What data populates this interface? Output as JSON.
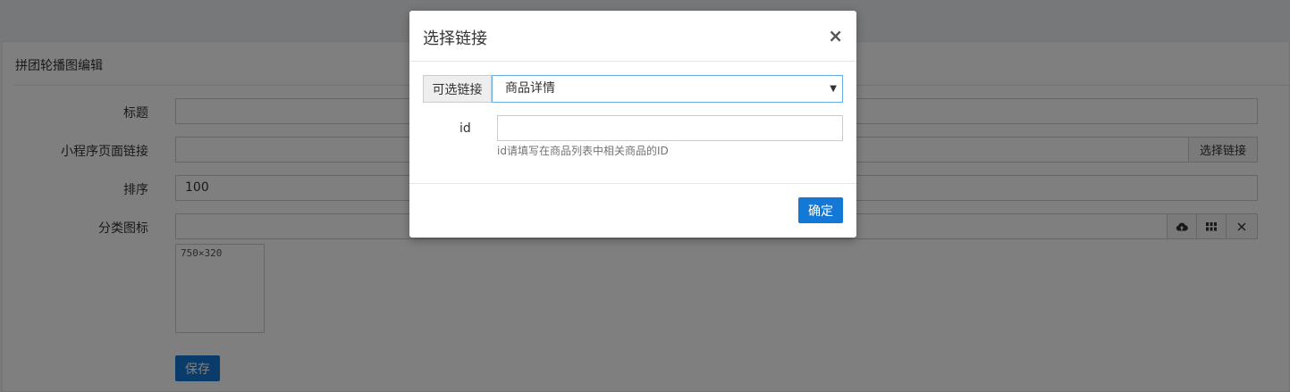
{
  "page": {
    "panel_title": "拼团轮播图编辑",
    "form": {
      "title_label": "标题",
      "title_value": "",
      "link_label": "小程序页面链接",
      "link_value": "",
      "choose_link_button": "选择链接",
      "sort_label": "排序",
      "sort_value": "100",
      "icon_label": "分类图标",
      "icon_value": "",
      "thumb_hint": "750×320",
      "save_button": "保存"
    }
  },
  "modal": {
    "title": "选择链接",
    "close_symbol": "×",
    "select_addon": "可选链接",
    "select_value": "商品详情",
    "id_label": "id",
    "id_value": "",
    "id_help": "id请填写在商品列表中相关商品的ID",
    "confirm_button": "确定"
  },
  "icons": [
    "upload-cloud-icon",
    "grid-icon",
    "close-icon",
    "select-caret-icon",
    "modal-close-icon"
  ],
  "colors": {
    "primary": "#1479d6",
    "overlay": "rgba(0,0,0,0.5)"
  }
}
